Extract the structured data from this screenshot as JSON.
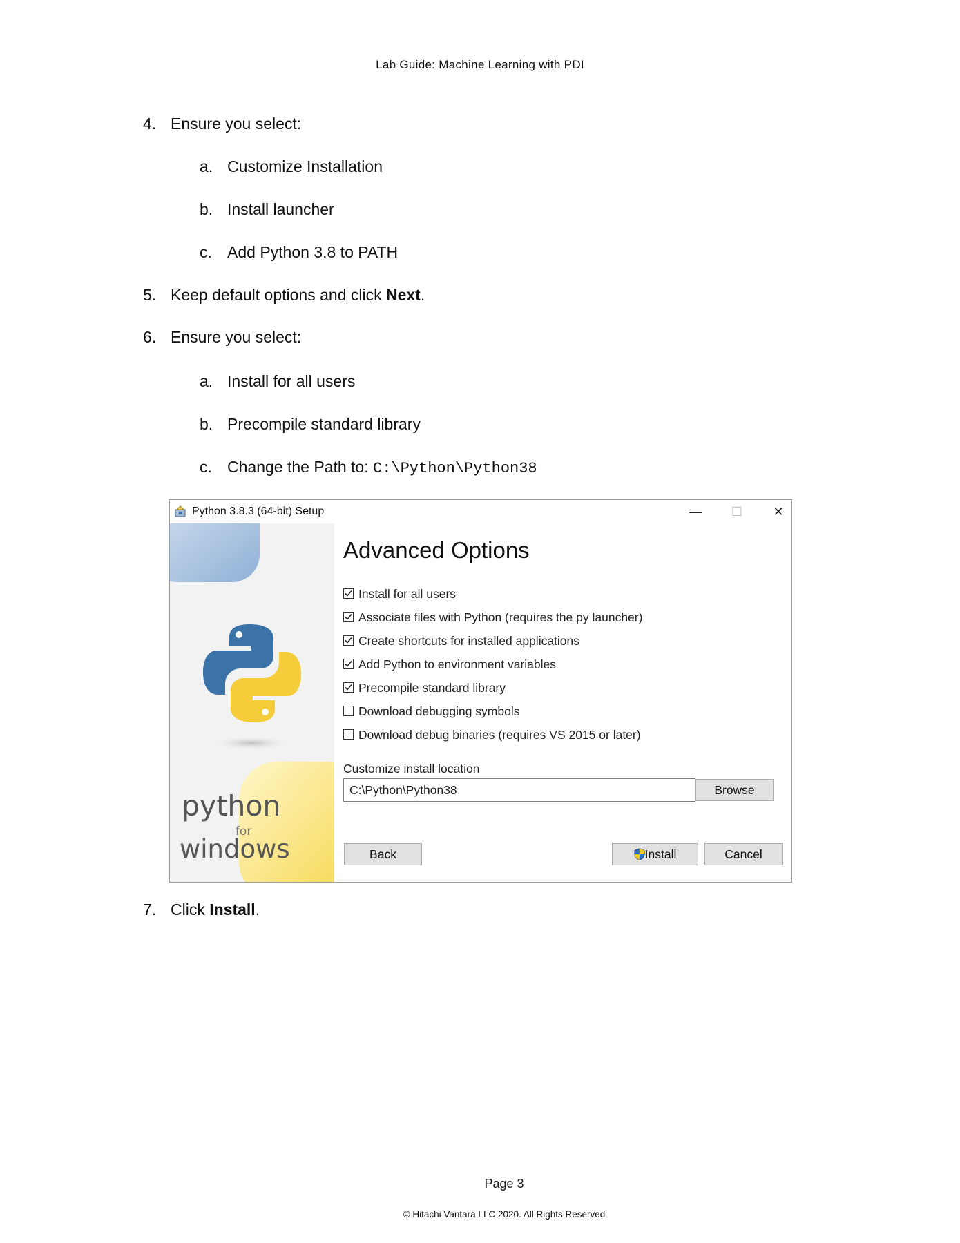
{
  "header": "Lab Guide: Machine Learning with PDI",
  "steps": {
    "s4": {
      "num": "4.",
      "text": "Ensure you select:"
    },
    "s4a": {
      "num": "a.",
      "text": "Customize Installation"
    },
    "s4b": {
      "num": "b.",
      "text": "Install launcher"
    },
    "s4c": {
      "num": "c.",
      "text": "Add Python 3.8 to PATH"
    },
    "s5": {
      "num": "5.",
      "text_before": "Keep default options and click ",
      "bold": "Next",
      "text_after": "."
    },
    "s6": {
      "num": "6.",
      "text": "Ensure you select:"
    },
    "s6a": {
      "num": "a.",
      "text": "Install for all users"
    },
    "s6b": {
      "num": "b.",
      "text": "Precompile standard library"
    },
    "s6c": {
      "num": "c.",
      "text": "Change the Path to: ",
      "path": "C:\\Python\\Python38"
    },
    "s7": {
      "num": "7.",
      "text_before": "Click ",
      "bold": "Install",
      "text_after": "."
    }
  },
  "dialog": {
    "title": "Python 3.8.3 (64-bit) Setup",
    "minimize": "—",
    "maximize": "☐",
    "close": "✕",
    "heading": "Advanced Options",
    "options": [
      {
        "label": "Install for all users",
        "checked": true
      },
      {
        "label": "Associate files with Python (requires the py launcher)",
        "checked": true
      },
      {
        "label": "Create shortcuts for installed applications",
        "checked": true
      },
      {
        "label": "Add Python to environment variables",
        "checked": true
      },
      {
        "label": "Precompile standard library",
        "checked": true
      },
      {
        "label": "Download debugging symbols",
        "checked": false
      },
      {
        "label": "Download debug binaries (requires VS 2015 or later)",
        "checked": false
      }
    ],
    "location_label": "Customize install location",
    "location_value": "C:\\Python\\Python38",
    "browse": "Browse",
    "back": "Back",
    "install": "Install",
    "cancel": "Cancel",
    "brand_python": "python",
    "brand_for": "for",
    "brand_windows": "windows"
  },
  "footer": {
    "page": "Page 3",
    "copyright": "© Hitachi Vantara LLC 2020. All Rights Reserved"
  }
}
